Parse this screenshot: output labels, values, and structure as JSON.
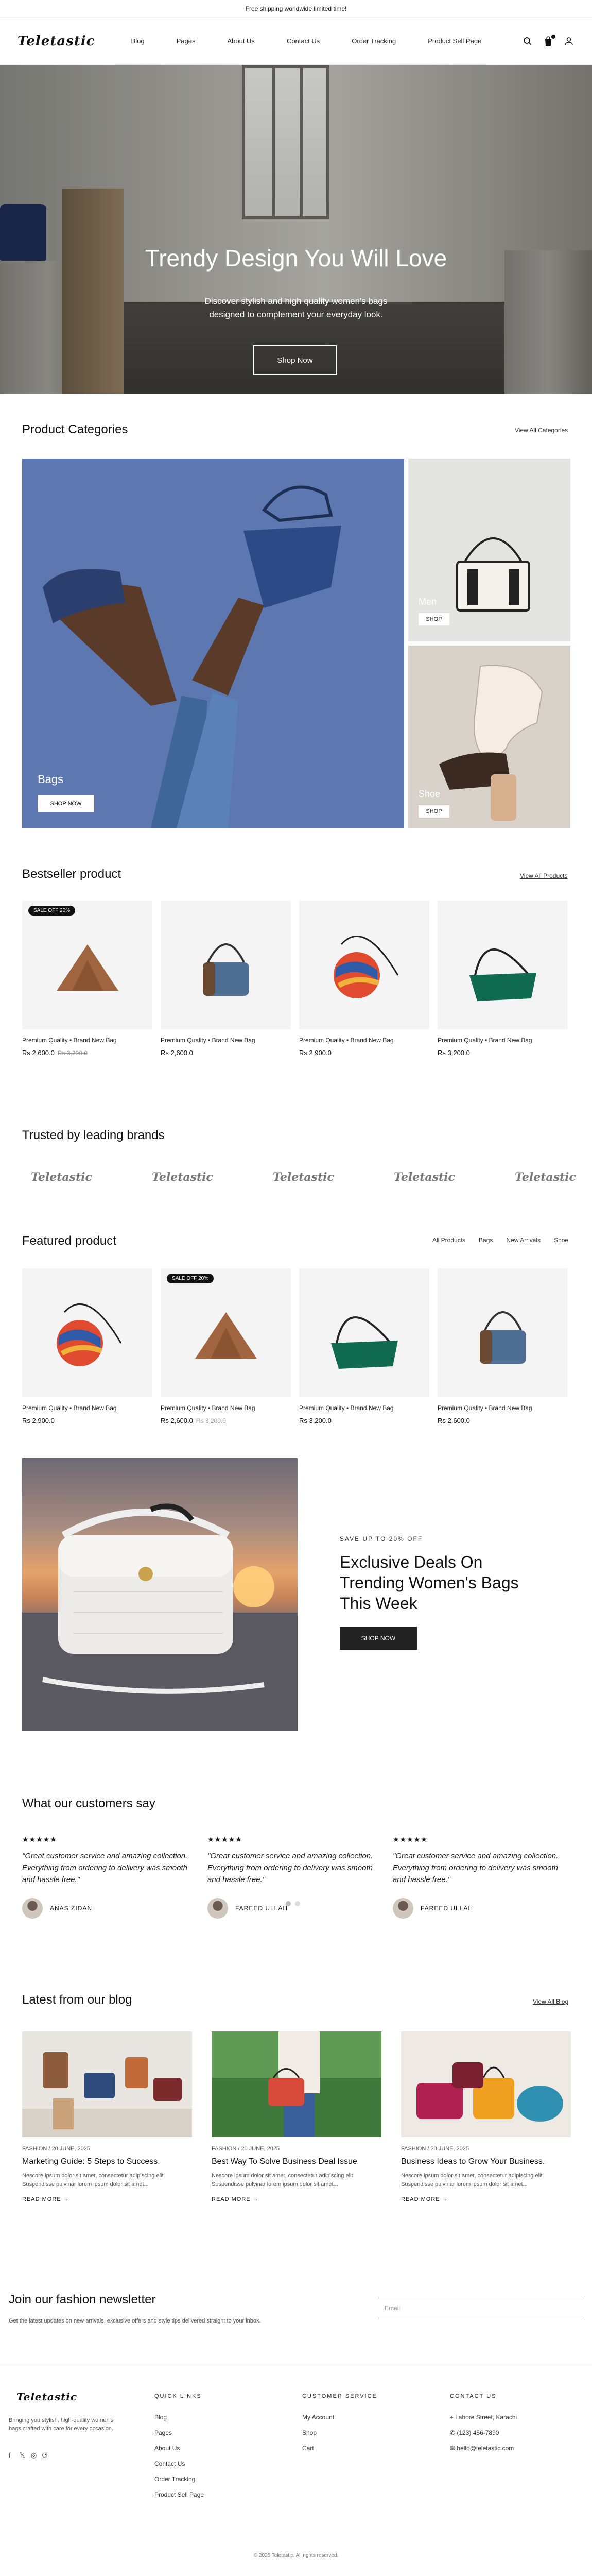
{
  "announcement": "Free shipping worldwide limited time!",
  "brand": {
    "logo": "Teletastic"
  },
  "nav": [
    "Blog",
    "Pages",
    "About Us",
    "Contact Us",
    "Order Tracking",
    "Product Sell Page"
  ],
  "hero": {
    "title": "Trendy Design You Will Love",
    "subtitle": "Discover stylish and high quality women's bags designed to complement your everyday look.",
    "button": "Shop Now"
  },
  "categories": {
    "title": "Product Categories",
    "view_all": "View All Categories",
    "items": [
      {
        "label": "Bags",
        "button": "SHOP NOW"
      },
      {
        "label": "Men",
        "button": "SHOP"
      },
      {
        "label": "Shoe",
        "button": "SHOP"
      }
    ]
  },
  "bestseller": {
    "title": "Bestseller product",
    "view_all": "View All Products",
    "products": [
      {
        "title": "Premium Quality • Brand New Bag",
        "price": "Rs 2,600.0",
        "old_price": "Rs 3,200.0",
        "badge": "SALE OFF 20%",
        "image": "brown-triangle-bag"
      },
      {
        "title": "Premium Quality • Brand New Bag",
        "price": "Rs 2,600.0",
        "old_price": "",
        "badge": "",
        "image": "blue-shoulder-bag"
      },
      {
        "title": "Premium Quality • Brand New Bag",
        "price": "Rs 2,900.0",
        "old_price": "",
        "badge": "",
        "image": "striped-crossbody-bag"
      },
      {
        "title": "Premium Quality • Brand New Bag",
        "price": "Rs 3,200.0",
        "old_price": "",
        "badge": "",
        "image": "green-baguette-bag"
      }
    ]
  },
  "brands": {
    "title": "Trusted by leading brands",
    "logos": [
      "Teletastic",
      "Teletastic",
      "Teletastic",
      "Teletastic",
      "Teletastic"
    ]
  },
  "featured": {
    "title": "Featured product",
    "tabs": [
      "All Products",
      "Bags",
      "New Arrivals",
      "Shoe"
    ],
    "products": [
      {
        "title": "Premium Quality • Brand New Bag",
        "price": "Rs 2,900.0",
        "old_price": "",
        "badge": "",
        "image": "striped-crossbody-bag"
      },
      {
        "title": "Premium Quality • Brand New Bag",
        "price": "Rs 2,600.0",
        "old_price": "Rs 3,200.0",
        "badge": "SALE OFF 20%",
        "image": "brown-triangle-bag"
      },
      {
        "title": "Premium Quality • Brand New Bag",
        "price": "Rs 3,200.0",
        "old_price": "",
        "badge": "",
        "image": "green-baguette-bag"
      },
      {
        "title": "Premium Quality • Brand New Bag",
        "price": "Rs 2,600.0",
        "old_price": "",
        "badge": "",
        "image": "blue-shoulder-bag"
      }
    ]
  },
  "deal": {
    "eyebrow": "SAVE UP TO 20% OFF",
    "title": "Exclusive Deals On Trending Women's Bags This Week",
    "button": "SHOP NOW"
  },
  "testimonials": {
    "title": "What our customers say",
    "items": [
      {
        "stars": "★★★★★",
        "quote": "\"Great customer service and amazing collection. Everything from ordering to delivery was smooth and hassle free.\"",
        "author": "ANAS ZIDAN"
      },
      {
        "stars": "★★★★★",
        "quote": "\"Great customer service and amazing collection. Everything from ordering to delivery was smooth and hassle free.\"",
        "author": "FAREED ULLAH"
      },
      {
        "stars": "★★★★★",
        "quote": "\"Great customer service and amazing collection. Everything from ordering to delivery was smooth and hassle free.\"",
        "author": "FAREED ULLAH"
      }
    ]
  },
  "blog": {
    "title": "Latest from our blog",
    "view_all": "View All Blog",
    "posts": [
      {
        "meta": "FASHION / 20 JUNE, 2025",
        "title": "Marketing Guide: 5 Steps to Success.",
        "excerpt": "Nescore ipsum dolor sit amet, consectetur adipiscing elit. Suspendisse pulvinar lorem ipsum dolor sit amet...",
        "read": "READ MORE →"
      },
      {
        "meta": "FASHION / 20 JUNE, 2025",
        "title": "Best Way To Solve Business Deal Issue",
        "excerpt": "Nescore ipsum dolor sit amet, consectetur adipiscing elit. Suspendisse pulvinar lorem ipsum dolor sit amet...",
        "read": "READ MORE →"
      },
      {
        "meta": "FASHION / 20 JUNE, 2025",
        "title": "Business Ideas to Grow Your Business.",
        "excerpt": "Nescore ipsum dolor sit amet, consectetur adipiscing elit. Suspendisse pulvinar lorem ipsum dolor sit amet...",
        "read": "READ MORE →"
      }
    ]
  },
  "newsletter": {
    "title": "Join our fashion newsletter",
    "subtitle": "Get the latest updates on new arrivals, exclusive offers and style tips delivered straight to your inbox.",
    "placeholder": "Email"
  },
  "footer": {
    "logo": "Teletastic",
    "description": "Bringing you stylish, high-quality women's bags crafted with care for every occasion.",
    "social": [
      "f",
      "𝕏",
      "◎",
      "℗"
    ],
    "quick_links_title": "QUICK LINKS",
    "quick_links": [
      "Blog",
      "Pages",
      "About Us",
      "Contact Us",
      "Order Tracking",
      "Product Sell Page"
    ],
    "customer_title": "CUSTOMER SERVICE",
    "customer_links": [
      "My Account",
      "Shop",
      "Cart"
    ],
    "contact_title": "CONTACT US",
    "contact": [
      "Lahore Street, Karachi",
      "(123) 456-7890",
      "hello@teletastic.com"
    ],
    "copyright": "© 2025 Teletastic. All rights reserved."
  }
}
